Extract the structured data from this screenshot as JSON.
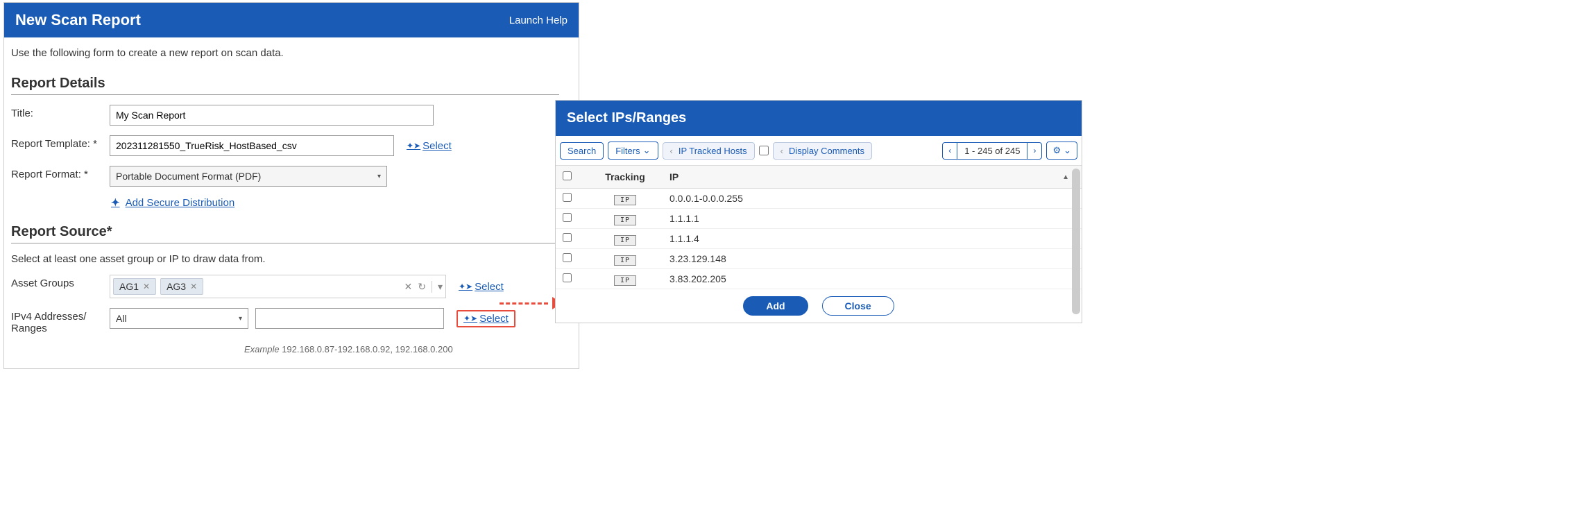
{
  "leftPanel": {
    "title": "New Scan Report",
    "helpLink": "Launch Help",
    "intro": "Use the following form to create a new report on scan data.",
    "sections": {
      "details": {
        "title": "Report Details",
        "titleLabel": "Title:",
        "titleValue": "My Scan Report",
        "templateLabel": "Report Template: *",
        "templateValue": "202311281550_TrueRisk_HostBased_csv",
        "selectLink": "Select",
        "formatLabel": "Report Format: *",
        "formatValue": "Portable Document Format (PDF)",
        "addSecure": "Add Secure Distribution"
      },
      "source": {
        "title": "Report Source*",
        "subtext": "Select at least one asset group or IP to draw data from.",
        "assetGroupsLabel": "Asset Groups",
        "tags": [
          "AG1",
          "AG3"
        ],
        "selectLink": "Select",
        "ipLabel": "IPv4 Addresses/ Ranges",
        "ipDropdown": "All",
        "ipSelectLink": "Select",
        "exampleLabel": "Example",
        "exampleText": "192.168.0.87-192.168.0.92, 192.168.0.200"
      }
    }
  },
  "rightPanel": {
    "title": "Select IPs/Ranges",
    "toolbar": {
      "search": "Search",
      "filters": "Filters",
      "ipTracked": "IP Tracked Hosts",
      "displayComments": "Display Comments",
      "pager": "1 - 245 of 245"
    },
    "columns": {
      "tracking": "Tracking",
      "ip": "IP"
    },
    "rows": [
      {
        "badge": "IP",
        "ip": "0.0.0.1-0.0.0.255"
      },
      {
        "badge": "IP",
        "ip": "1.1.1.1"
      },
      {
        "badge": "IP",
        "ip": "1.1.1.4"
      },
      {
        "badge": "IP",
        "ip": "3.23.129.148"
      },
      {
        "badge": "IP",
        "ip": "3.83.202.205"
      }
    ],
    "footer": {
      "add": "Add",
      "close": "Close"
    }
  }
}
